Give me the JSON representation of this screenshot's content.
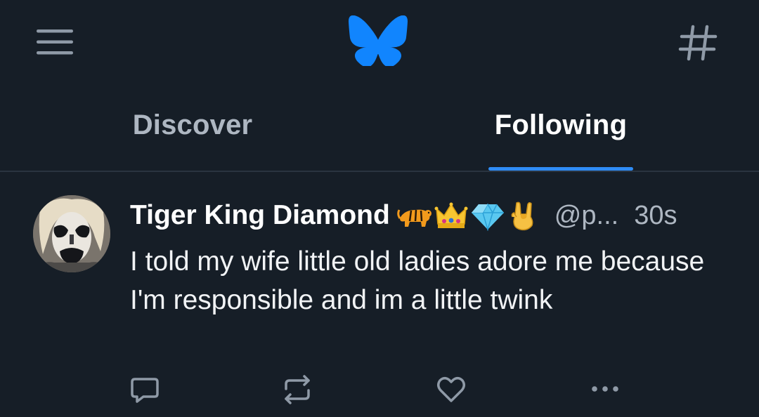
{
  "app": {
    "logo_icon": "bluesky-butterfly-icon",
    "accent_color": "#2f8cf5",
    "background_color": "#161e27"
  },
  "topbar": {
    "menu_icon": "hamburger-menu-icon",
    "feeds_icon": "hash-icon"
  },
  "tabs": [
    {
      "label": "Discover",
      "active": false
    },
    {
      "label": "Following",
      "active": true
    }
  ],
  "post": {
    "author_name": "Tiger King Diamond",
    "emojis": [
      "tiger-emoji",
      "crown-emoji",
      "gem-emoji",
      "rock-on-hand-emoji"
    ],
    "handle": "@p...",
    "timestamp": "30s",
    "text": "I told my wife little old ladies adore me because I'm responsible and im a little twink",
    "actions": [
      {
        "name": "reply",
        "icon": "comment-icon"
      },
      {
        "name": "repost",
        "icon": "repost-icon"
      },
      {
        "name": "like",
        "icon": "heart-icon"
      },
      {
        "name": "more",
        "icon": "more-dots-icon"
      }
    ]
  }
}
